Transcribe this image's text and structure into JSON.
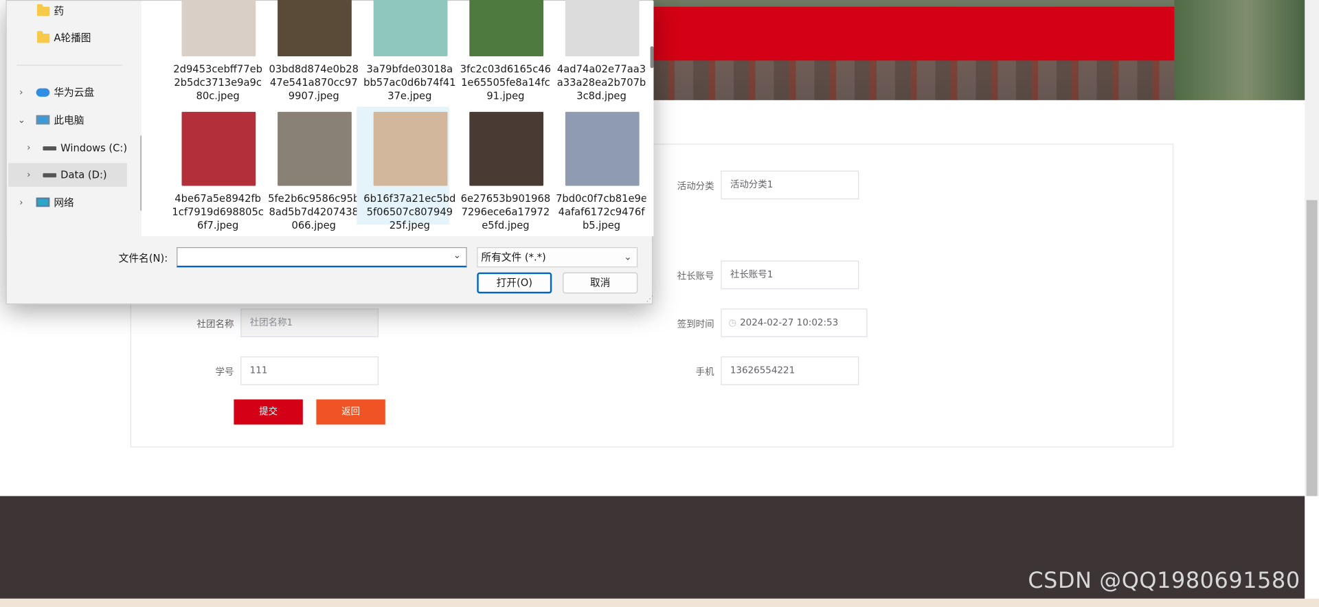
{
  "dialog": {
    "nav": {
      "items": [
        {
          "label": "药",
          "icon": "folder-icon"
        },
        {
          "label": "A轮播图",
          "icon": "folder-icon"
        },
        {
          "label": "华为云盘",
          "icon": "cloud-icon"
        },
        {
          "label": "此电脑",
          "icon": "pc-icon"
        },
        {
          "label": "Windows (C:)",
          "icon": "drive-icon"
        },
        {
          "label": "Data (D:)",
          "icon": "drive-icon"
        },
        {
          "label": "网络",
          "icon": "network-icon"
        }
      ]
    },
    "files": [
      {
        "name": "2d9453cebff77eb2b5dc3713e9a9c80c.jpeg",
        "color": "#d9cfc6"
      },
      {
        "name": "03bd8d874e0b2847e541a870cc979907.jpeg",
        "color": "#5a4a38"
      },
      {
        "name": "3a79bfde03018abb57ac0d6b74f4137e.jpeg",
        "color": "#8fc7be"
      },
      {
        "name": "3fc2c03d6165c461e65505fe8a14fc91.jpeg",
        "color": "#4f7a3f"
      },
      {
        "name": "4ad74a02e77aa3a33a28ea2b707b3c8d.jpeg",
        "color": "#dcdcdc"
      },
      {
        "name": "4be67a5e8942fb1cf7919d698805c6f7.jpeg",
        "color": "#b3303a"
      },
      {
        "name": "5fe2b6c9586c95b8ad5b7d4207438066.jpeg",
        "color": "#8a8176"
      },
      {
        "name": "6b16f37a21ec5bd5f06507c80794925f.jpeg",
        "color": "#d2b79c"
      },
      {
        "name": "6e27653b9019687296ece6a17972e5fd.jpeg",
        "color": "#4a3a34"
      },
      {
        "name": "7bd0c0f7cb81e9e4afaf6172c9476fb5.jpeg",
        "color": "#8e9bb0"
      }
    ],
    "filename_label": "文件名(N):",
    "filename_value": "",
    "filetype": "所有文件 (*.*)",
    "open_label": "打开(O)",
    "cancel_label": "取消"
  },
  "form": {
    "category_label": "活动分类",
    "category_value": "活动分类1",
    "president_label": "社长账号",
    "president_value": "社长账号1",
    "club_label": "社团名称",
    "club_value": "社团名称1",
    "checkin_label": "签到时间",
    "checkin_value": "2024-02-27 10:02:53",
    "student_label": "学号",
    "student_value": "111",
    "phone_label": "手机",
    "phone_value": "13626554221",
    "submit_label": "提交",
    "back_label": "返回"
  },
  "watermark": "CSDN @QQ1980691580",
  "colors": {
    "brand_red": "#d40015",
    "back_orange": "#f05424",
    "footer": "#3d3435",
    "focus_blue": "#0067c0"
  }
}
